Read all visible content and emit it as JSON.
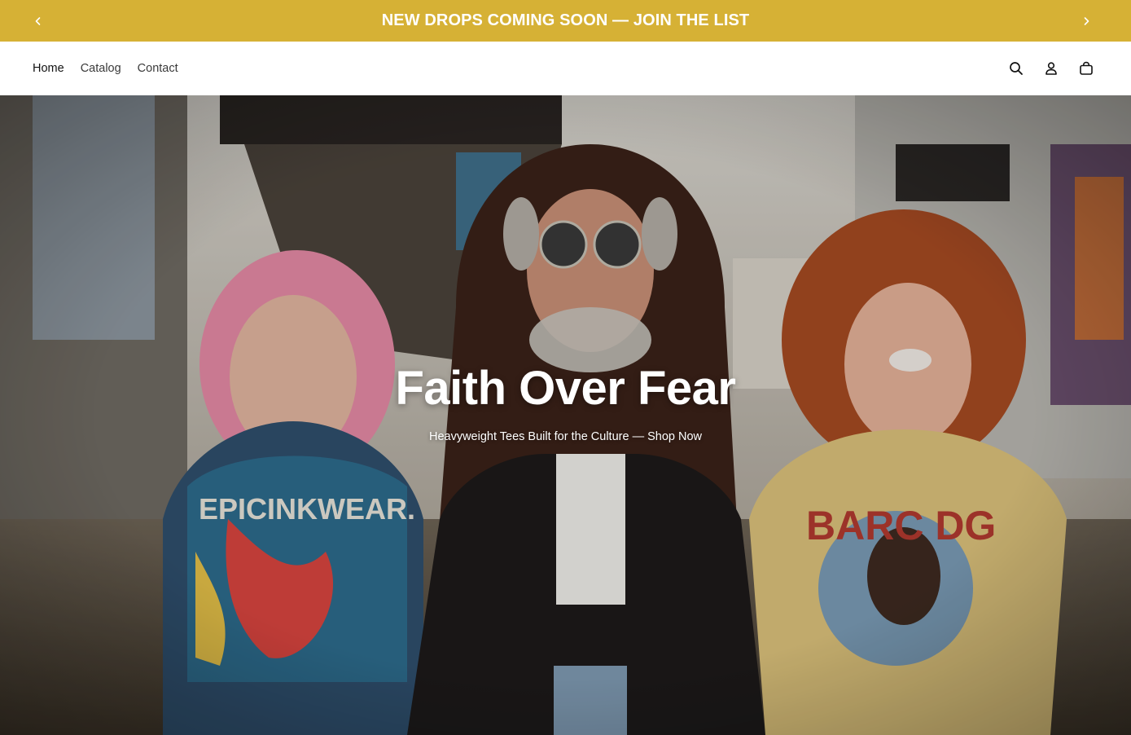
{
  "announcement": {
    "text": "NEW DROPS COMING SOON — JOIN THE LIST",
    "prev_icon": "chevron-left-icon",
    "next_icon": "chevron-right-icon",
    "background": "#d6b135"
  },
  "nav": {
    "items": [
      {
        "label": "Home"
      },
      {
        "label": "Catalog"
      },
      {
        "label": "Contact"
      }
    ]
  },
  "header_icons": [
    "search-icon",
    "account-icon",
    "cart-icon"
  ],
  "hero": {
    "title": "Faith Over Fear",
    "subtitle": "Heavyweight Tees Built for the Culture — Shop Now",
    "shirts": [
      {
        "print": "EPICINKWEAR."
      },
      {
        "print": "BARC DG"
      }
    ]
  }
}
